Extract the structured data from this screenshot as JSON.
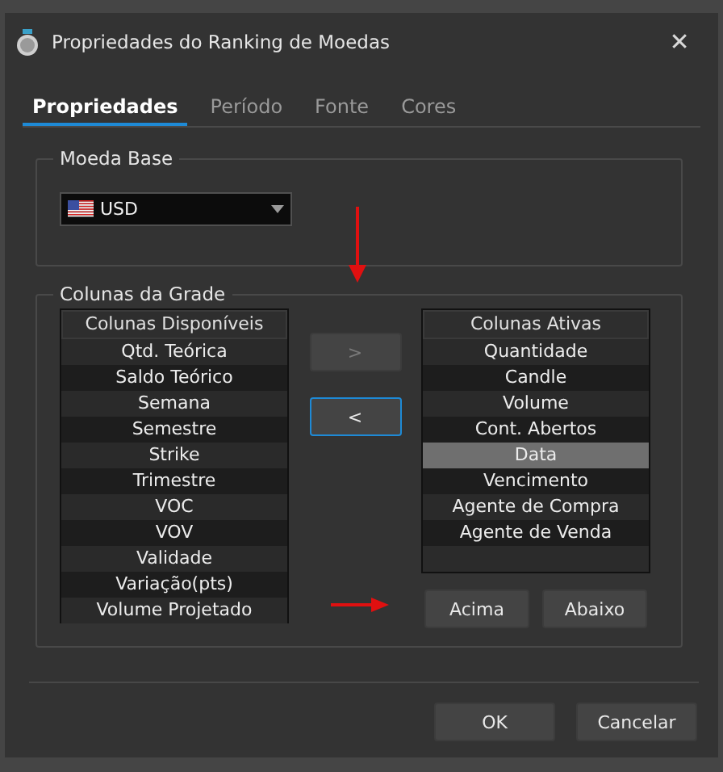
{
  "window": {
    "title": "Propriedades do Ranking de Moedas",
    "close": "✕"
  },
  "tabs": [
    {
      "label": "Propriedades",
      "selected": true
    },
    {
      "label": "Período",
      "selected": false
    },
    {
      "label": "Fonte",
      "selected": false
    },
    {
      "label": "Cores",
      "selected": false
    }
  ],
  "base_currency": {
    "title": "Moeda Base",
    "value": "USD"
  },
  "grid_columns": {
    "title": "Colunas da Grade",
    "available": {
      "header": "Colunas Disponíveis",
      "items": [
        {
          "label": "Qtd. Teórica",
          "selected": false
        },
        {
          "label": "Saldo Teórico",
          "selected": false
        },
        {
          "label": "Semana",
          "selected": false
        },
        {
          "label": "Semestre",
          "selected": false
        },
        {
          "label": "Strike",
          "selected": false
        },
        {
          "label": "Trimestre",
          "selected": false
        },
        {
          "label": "VOC",
          "selected": false
        },
        {
          "label": "VOV",
          "selected": false
        },
        {
          "label": "Validade",
          "selected": false
        },
        {
          "label": "Variação(pts)",
          "selected": false
        },
        {
          "label": "Volume Projetado",
          "selected": false
        }
      ]
    },
    "move_buttons": [
      {
        "label": ">",
        "disabled": true,
        "focused": false
      },
      {
        "label": "<",
        "disabled": false,
        "focused": true
      }
    ],
    "active": {
      "header": "Colunas Ativas",
      "items": [
        {
          "label": "Quantidade",
          "selected": false
        },
        {
          "label": "Candle",
          "selected": false
        },
        {
          "label": "Volume",
          "selected": false
        },
        {
          "label": "Cont. Abertos",
          "selected": false
        },
        {
          "label": "Data",
          "selected": true
        },
        {
          "label": "Vencimento",
          "selected": false
        },
        {
          "label": "Agente de Compra",
          "selected": false
        },
        {
          "label": "Agente de Venda",
          "selected": false
        }
      ]
    },
    "order_buttons": [
      "Acima",
      "Abaixo"
    ]
  },
  "footer_buttons": [
    "OK",
    "Cancelar"
  ]
}
